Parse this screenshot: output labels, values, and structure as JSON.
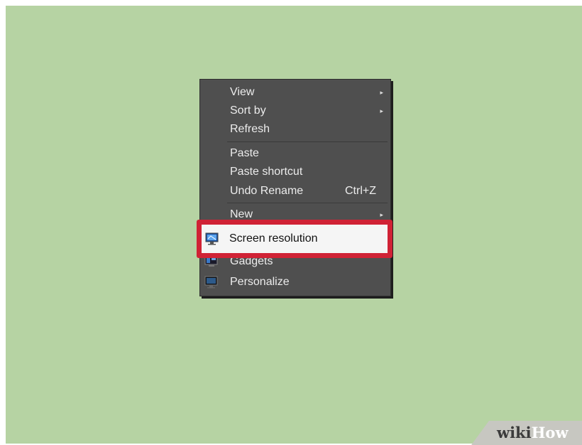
{
  "context_menu": {
    "groups": [
      [
        {
          "label": "View",
          "submenu_arrow": "▸"
        },
        {
          "label": "Sort by",
          "submenu_arrow": "▸"
        },
        {
          "label": "Refresh"
        }
      ],
      [
        {
          "label": "Paste"
        },
        {
          "label": "Paste shortcut"
        },
        {
          "label": "Undo Rename",
          "shortcut": "Ctrl+Z"
        }
      ],
      [
        {
          "label": "New",
          "submenu_arrow": "▸"
        }
      ],
      [
        {
          "label": "Screen resolution",
          "icon": "monitor-icon",
          "highlighted": true
        },
        {
          "label": "Gadgets",
          "icon": "gadgets-icon"
        },
        {
          "label": "Personalize",
          "icon": "personalize-icon"
        }
      ]
    ]
  },
  "watermark": {
    "part1": "wiki",
    "part2": "How"
  },
  "colors": {
    "desktop_background": "#b6d3a3",
    "menu_background": "#4f4f4f",
    "highlight_border": "#d02235",
    "highlight_fill": "#f5f5f5"
  }
}
